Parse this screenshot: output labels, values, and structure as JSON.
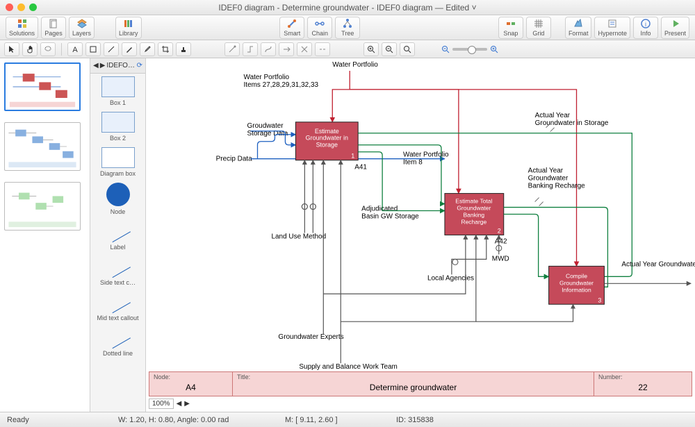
{
  "window": {
    "title": "IDEF0 diagram - Determine groundwater - IDEF0 diagram — Edited ˅",
    "traffic": {
      "close": "#ff5f57",
      "min": "#febc2e",
      "max": "#28c840"
    }
  },
  "toolbar": {
    "left": [
      {
        "id": "solutions",
        "label": "Solutions"
      },
      {
        "id": "pages",
        "label": "Pages"
      },
      {
        "id": "layers",
        "label": "Layers"
      }
    ],
    "left2": [
      {
        "id": "library",
        "label": "Library"
      }
    ],
    "center": [
      {
        "id": "smart",
        "label": "Smart"
      },
      {
        "id": "chain",
        "label": "Chain"
      },
      {
        "id": "tree",
        "label": "Tree"
      }
    ],
    "right1": [
      {
        "id": "snap",
        "label": "Snap"
      },
      {
        "id": "grid",
        "label": "Grid"
      }
    ],
    "right2": [
      {
        "id": "format",
        "label": "Format"
      },
      {
        "id": "hypernote",
        "label": "Hypernote"
      },
      {
        "id": "info",
        "label": "Info"
      },
      {
        "id": "present",
        "label": "Present"
      }
    ]
  },
  "library": {
    "header": "IDEFO…",
    "items": [
      {
        "label": "Box 1"
      },
      {
        "label": "Box 2"
      },
      {
        "label": "Diagram box"
      },
      {
        "label": "Node"
      },
      {
        "label": "Label"
      },
      {
        "label": "Side text c…"
      },
      {
        "label": "Mid text callout"
      },
      {
        "label": "Dotted line"
      }
    ]
  },
  "diagram": {
    "control_top": "Water Portfolio",
    "input1": "Water Portfolio\nItems 27,28,29,31,32,33",
    "input2": "Groudwater\nStorage Data",
    "input3": "Precip Data",
    "box1": {
      "title": "Estimate\nGroundwater in\nStorage",
      "num": "1",
      "code": "A41"
    },
    "box2": {
      "title": "Estimate Total\nGroundwater\nBanking\nRecharge",
      "num": "2",
      "code": "A42"
    },
    "box3": {
      "title": "Compile\nGroundwater\nInformation",
      "num": "3"
    },
    "out1": "Actual Year\nGroundwater in Storage",
    "mid1": "Water Portfolio\nItem 8",
    "out2": "Actual Year\nGroundwater\nBanking Recharge",
    "out3": "Actual Year Groundwater",
    "mid2": "Adjudicated\nBasin GW Storage",
    "mech1": "Land Use Method",
    "mech2": "Groundwater Experts",
    "mech3": "Supply and Balance Work Team",
    "mech4": "Local Agencies",
    "mech5": "MWD",
    "footer": {
      "node_lbl": "Node:",
      "node_val": "A4",
      "title_lbl": "Title:",
      "title_val": "Determine groundwater",
      "num_lbl": "Number:",
      "num_val": "22"
    },
    "zoom": "100%"
  },
  "status": {
    "ready": "Ready",
    "wh": "W: 1.20,   H: 0.80,   Angle: 0.00 rad",
    "mouse": "M: [ 9.11, 2.60 ]",
    "id": "ID: 315838"
  }
}
